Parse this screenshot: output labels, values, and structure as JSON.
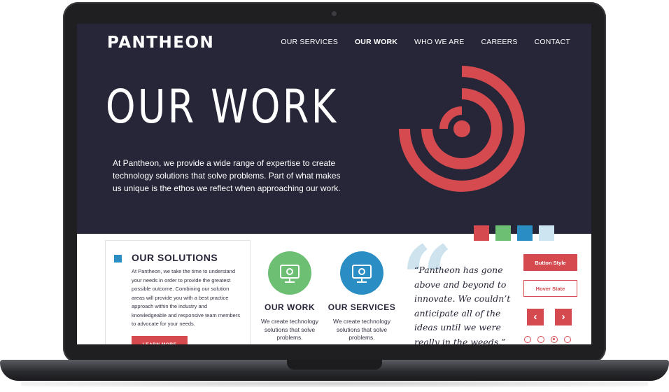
{
  "header": {
    "logo_text": "PANTHEON",
    "nav": [
      {
        "label": "OUR SERVICES",
        "active": false
      },
      {
        "label": "OUR WORK",
        "active": true
      },
      {
        "label": "WHO WE ARE",
        "active": false
      },
      {
        "label": "CAREERS",
        "active": false
      },
      {
        "label": "CONTACT",
        "active": false
      }
    ]
  },
  "hero": {
    "title": "OUR WORK",
    "description": "At Pantheon, we provide a wide range of expertise to create technology solutions that solve problems. Part of what makes us unique is the ethos we reflect when approaching our work."
  },
  "color_squares": [
    "#d44a4f",
    "#6cbf73",
    "#2a8ec4",
    "#cde4f1"
  ],
  "solutions": {
    "title": "OUR SOLUTIONS",
    "text": "At Pantheon, we take the time to understand your needs in order to provide the greatest possible outcome. Combining our solution areas will provide you with a best practice approach within the industry and knowledgeable and responsive team members to advocate for your needs.",
    "button_label": "LEARN MORE"
  },
  "features": [
    {
      "title": "OUR WORK",
      "text": "We create technology solutions that solve problems.",
      "icon": "monitor-gear-icon",
      "color": "#6cbf73"
    },
    {
      "title": "OUR SERVICES",
      "text": "We create technology solutions that solve problems.",
      "icon": "monitor-gear-icon",
      "color": "#2a8ec4"
    }
  ],
  "quote": {
    "text": "“Pantheon has gone above and beyond to innovate. We couldn’t anticipate all of the ideas until we were really in the weeds.”"
  },
  "controls": {
    "button_style_label": "Button Style",
    "hover_state_label": "Hover State",
    "prev_arrow": "‹",
    "next_arrow": "›",
    "dots_count": 4,
    "active_dot": 2
  },
  "colors": {
    "hero_bg": "#262638",
    "accent_red": "#d44a4f",
    "green": "#6cbf73",
    "blue": "#2a8ec4"
  }
}
